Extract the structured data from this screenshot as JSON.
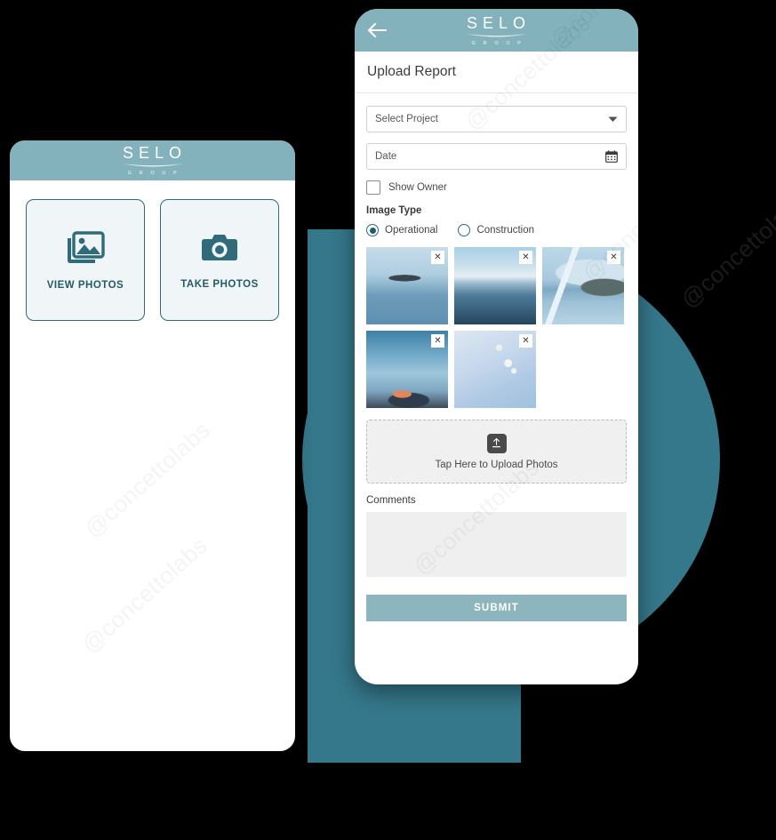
{
  "brand": {
    "logo_word": "SELO",
    "logo_sub": "G R O U P",
    "header_color": "#83B2BC",
    "accent_color": "#2F6B78",
    "decor_color": "#35788B",
    "submit_color": "#8DB5BD"
  },
  "watermark": {
    "text": "@concettolabs"
  },
  "left_phone": {
    "tiles": [
      {
        "label": "VIEW PHOTOS",
        "icon": "images-icon"
      },
      {
        "label": "TAKE PHOTOS",
        "icon": "camera-icon"
      }
    ]
  },
  "right_phone": {
    "back_icon": "back-arrow-icon",
    "screen_title": "Upload Report",
    "form": {
      "project_select": {
        "value": "Select Project",
        "icon": "chevron-down-icon"
      },
      "date_field": {
        "value": "Date",
        "icon": "calendar-icon"
      },
      "show_owner": {
        "label": "Show Owner",
        "checked": false
      },
      "image_type": {
        "label": "Image Type",
        "options": [
          {
            "label": "Operational",
            "selected": true
          },
          {
            "label": "Construction",
            "selected": false
          }
        ]
      },
      "thumbnails": [
        {
          "alt": "boat-on-calm-water",
          "art": "ph-boat",
          "close_icon": "close-icon"
        },
        {
          "alt": "sea-horizon",
          "art": "ph-sea",
          "close_icon": "close-icon"
        },
        {
          "alt": "snowy-mountain-shore",
          "art": "ph-mountain",
          "close_icon": "close-icon"
        },
        {
          "alt": "clouds-at-dusk",
          "art": "ph-cloud",
          "close_icon": "close-icon"
        },
        {
          "alt": "white-blossom-branch",
          "art": "ph-flower",
          "close_icon": "close-icon"
        }
      ],
      "dropzone": {
        "icon": "upload-icon",
        "text": "Tap Here to Upload Photos"
      },
      "comments": {
        "label": "Comments",
        "value": "",
        "placeholder": ""
      },
      "submit_label": "SUBMIT"
    }
  }
}
